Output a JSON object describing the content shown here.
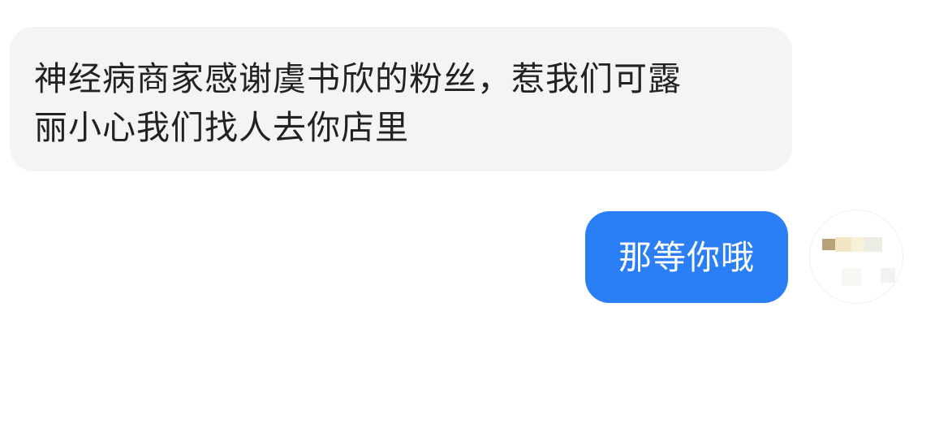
{
  "messages": [
    {
      "direction": "incoming",
      "text": "神经病商家感谢虞书欣的粉丝，惹我们可露\n丽小心我们找人去你店里",
      "bubble_color": "#f4f4f4"
    },
    {
      "direction": "outgoing",
      "text": "那等你哦",
      "bubble_color": "#2b7ff6"
    }
  ],
  "avatar": {
    "icon": "user-avatar-pixelated",
    "colors": [
      "#b8a27a",
      "#f3e6c4",
      "#f6f1d8",
      "#ecebe4",
      "#f7f7f4"
    ]
  }
}
